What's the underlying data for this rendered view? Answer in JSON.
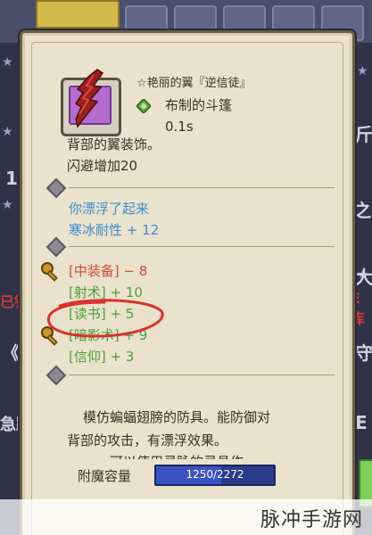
{
  "background": {
    "side_texts": [
      "斤",
      "1",
      "之",
      "大",
      "已铁",
      "E库",
      "《",
      "守",
      "急踊",
      "E"
    ]
  },
  "item": {
    "icon": "wing-icon",
    "title": "☆艳丽的翼『逆信徒』",
    "material_icon": "green-gem-icon",
    "material": "布制的斗篷",
    "weight": "0.1s",
    "desc_lines": [
      "背部的翼装饰。",
      "闪避增加20"
    ]
  },
  "effects": {
    "blue_lines": [
      "你漂浮了起来",
      "寒冰耐性 + 12"
    ]
  },
  "requirements": [
    {
      "label": "[中装备] − 8",
      "color": "red"
    },
    {
      "label": "[射术] + 10",
      "color": "green"
    },
    {
      "label": "[读书] + 5",
      "color": "green"
    },
    {
      "label": "[暗影术] + 9",
      "color": "green"
    },
    {
      "label": "[信仰] + 3",
      "color": "green"
    }
  ],
  "flavor": {
    "lines": [
      "模仿蝙蝠翅膀的防具。能防御对",
      "背部的攻击，有漂浮效果。"
    ],
    "cut_line": "可以使用灵脉的灵具作"
  },
  "enchant": {
    "label": "附魔容量",
    "current": 1250,
    "max": 2272,
    "text": "1250/2272"
  },
  "colors": {
    "panel": "#eae2cc",
    "blue": "#3d8bd0",
    "red": "#cf4b3c",
    "green": "#4c9f3d",
    "annotation": "#d9322e"
  },
  "watermark": "脉冲手游网"
}
